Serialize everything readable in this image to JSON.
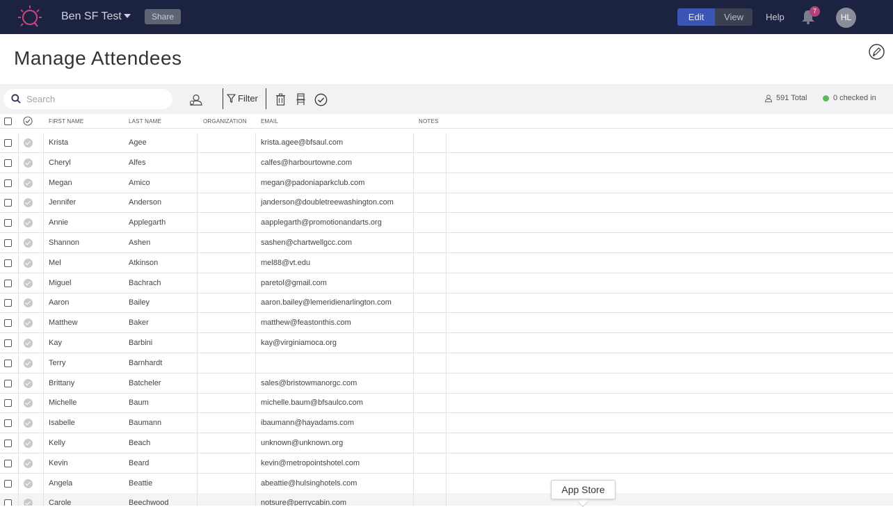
{
  "app": {
    "event_title": "Ben SF Test",
    "share_label": "Share",
    "edit_label": "Edit",
    "view_label": "View",
    "help_label": "Help",
    "notification_count": "7",
    "avatar_initials": "HL"
  },
  "page": {
    "title": "Manage Attendees"
  },
  "toolbar": {
    "search_placeholder": "Search",
    "filter_label": "Filter",
    "total_label": "591 Total",
    "checked_in_label": "0 checked in"
  },
  "table": {
    "columns": [
      "FIRST NAME",
      "LAST NAME",
      "ORGANIZATION",
      "EMAIL",
      "NOTES"
    ],
    "rows": [
      {
        "first": "Krista",
        "last": "Agee",
        "org": "",
        "email": "krista.agee@bfsaul.com"
      },
      {
        "first": "Cheryl",
        "last": "Alfes",
        "org": "",
        "email": "calfes@harbourtowne.com"
      },
      {
        "first": "Megan",
        "last": "Amico",
        "org": "",
        "email": "megan@padoniaparkclub.com"
      },
      {
        "first": "Jennifer",
        "last": "Anderson",
        "org": "",
        "email": "janderson@doubletreewashington.com"
      },
      {
        "first": "Annie",
        "last": "Applegarth",
        "org": "",
        "email": "aapplegarth@promotionandarts.org"
      },
      {
        "first": "Shannon",
        "last": "Ashen",
        "org": "",
        "email": "sashen@chartwellgcc.com"
      },
      {
        "first": "Mel",
        "last": "Atkinson",
        "org": "",
        "email": "mel88@vt.edu"
      },
      {
        "first": "Miguel",
        "last": "Bachrach",
        "org": "",
        "email": "paretol@gmail.com"
      },
      {
        "first": "Aaron",
        "last": "Bailey",
        "org": "",
        "email": "aaron.bailey@lemeridienarlington.com"
      },
      {
        "first": "Matthew",
        "last": "Baker",
        "org": "",
        "email": "matthew@feastonthis.com"
      },
      {
        "first": "Kay",
        "last": "Barbini",
        "org": "",
        "email": "kay@virginiamoca.org"
      },
      {
        "first": "Terry",
        "last": "Barnhardt",
        "org": "",
        "email": ""
      },
      {
        "first": "Brittany",
        "last": "Batcheler",
        "org": "",
        "email": "sales@bristowmanorgc.com"
      },
      {
        "first": "Michelle",
        "last": "Baum",
        "org": "",
        "email": "michelle.baum@bfsaulco.com"
      },
      {
        "first": "Isabelle",
        "last": "Baumann",
        "org": "",
        "email": "ibaumann@hayadams.com"
      },
      {
        "first": "Kelly",
        "last": "Beach",
        "org": "",
        "email": "unknown@unknown.org"
      },
      {
        "first": "Kevin",
        "last": "Beard",
        "org": "",
        "email": "kevin@metropointshotel.com"
      },
      {
        "first": "Angela",
        "last": "Beattie",
        "org": "",
        "email": "abeattie@hulsinghotels.com"
      },
      {
        "first": "Carole",
        "last": "Beechwood",
        "org": "",
        "email": "notsure@perrycabin.com"
      }
    ]
  },
  "tooltip": {
    "label": "App Store"
  },
  "colors": {
    "nav_bg": "#1c2340",
    "accent": "#3a55b3",
    "badge": "#b3427a",
    "checked_dot": "#5cb85c"
  }
}
